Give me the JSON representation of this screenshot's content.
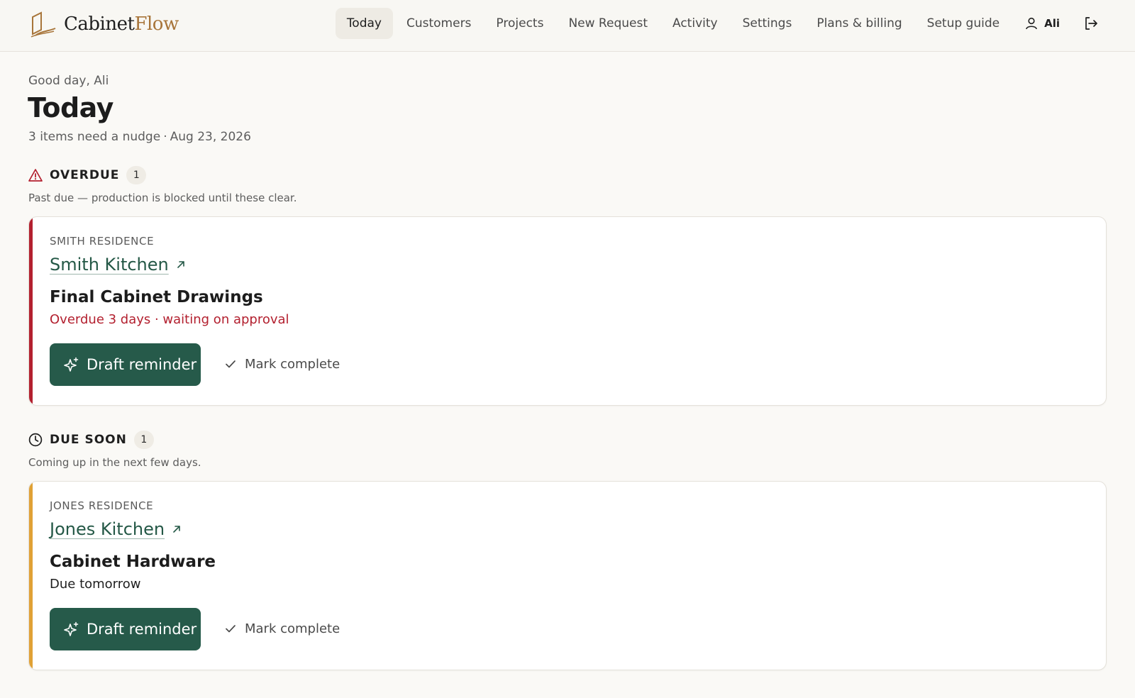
{
  "brand": {
    "name_part1": "Cabinet",
    "name_part2": "Flow"
  },
  "nav": {
    "items": [
      {
        "label": "Today",
        "active": true
      },
      {
        "label": "Customers"
      },
      {
        "label": "Projects"
      },
      {
        "label": "New Request"
      },
      {
        "label": "Activity"
      },
      {
        "label": "Settings"
      },
      {
        "label": "Plans & billing"
      },
      {
        "label": "Setup guide"
      }
    ],
    "user_name": "Ali",
    "icons": {
      "user": "user-icon",
      "logout": "logout-icon"
    }
  },
  "page": {
    "greeting": "Good day, Ali",
    "title": "Today",
    "summary": "3 items need a nudge",
    "date": "Aug 23, 2026"
  },
  "sections": [
    {
      "title": "OVERDUE",
      "count": "1",
      "icon": "warning-triangle-icon",
      "description": "Past due — production is blocked until these clear.",
      "accent_color": "#b3202f",
      "cards": [
        {
          "residence": "SMITH RESIDENCE",
          "project": "Smith Kitchen",
          "item": "Final Cabinet Drawings",
          "status": "Overdue 3 days · waiting on approval",
          "status_color": "#b3202f",
          "primary_action": "Draft reminder",
          "secondary_action": "Mark complete"
        }
      ]
    },
    {
      "title": "DUE SOON",
      "count": "1",
      "icon": "clock-icon",
      "description": "Coming up in the next few days.",
      "accent_color": "#e0a135",
      "cards": [
        {
          "residence": "JONES RESIDENCE",
          "project": "Jones Kitchen",
          "item": "Cabinet Hardware",
          "status": "Due tomorrow",
          "status_color": "#1f1f1f",
          "primary_action": "Draft reminder",
          "secondary_action": "Mark complete"
        }
      ]
    }
  ],
  "colors": {
    "primary": "#265a4a",
    "link": "#245846",
    "danger": "#b3202f",
    "warning": "#e0a135",
    "background": "#faf9f6"
  }
}
